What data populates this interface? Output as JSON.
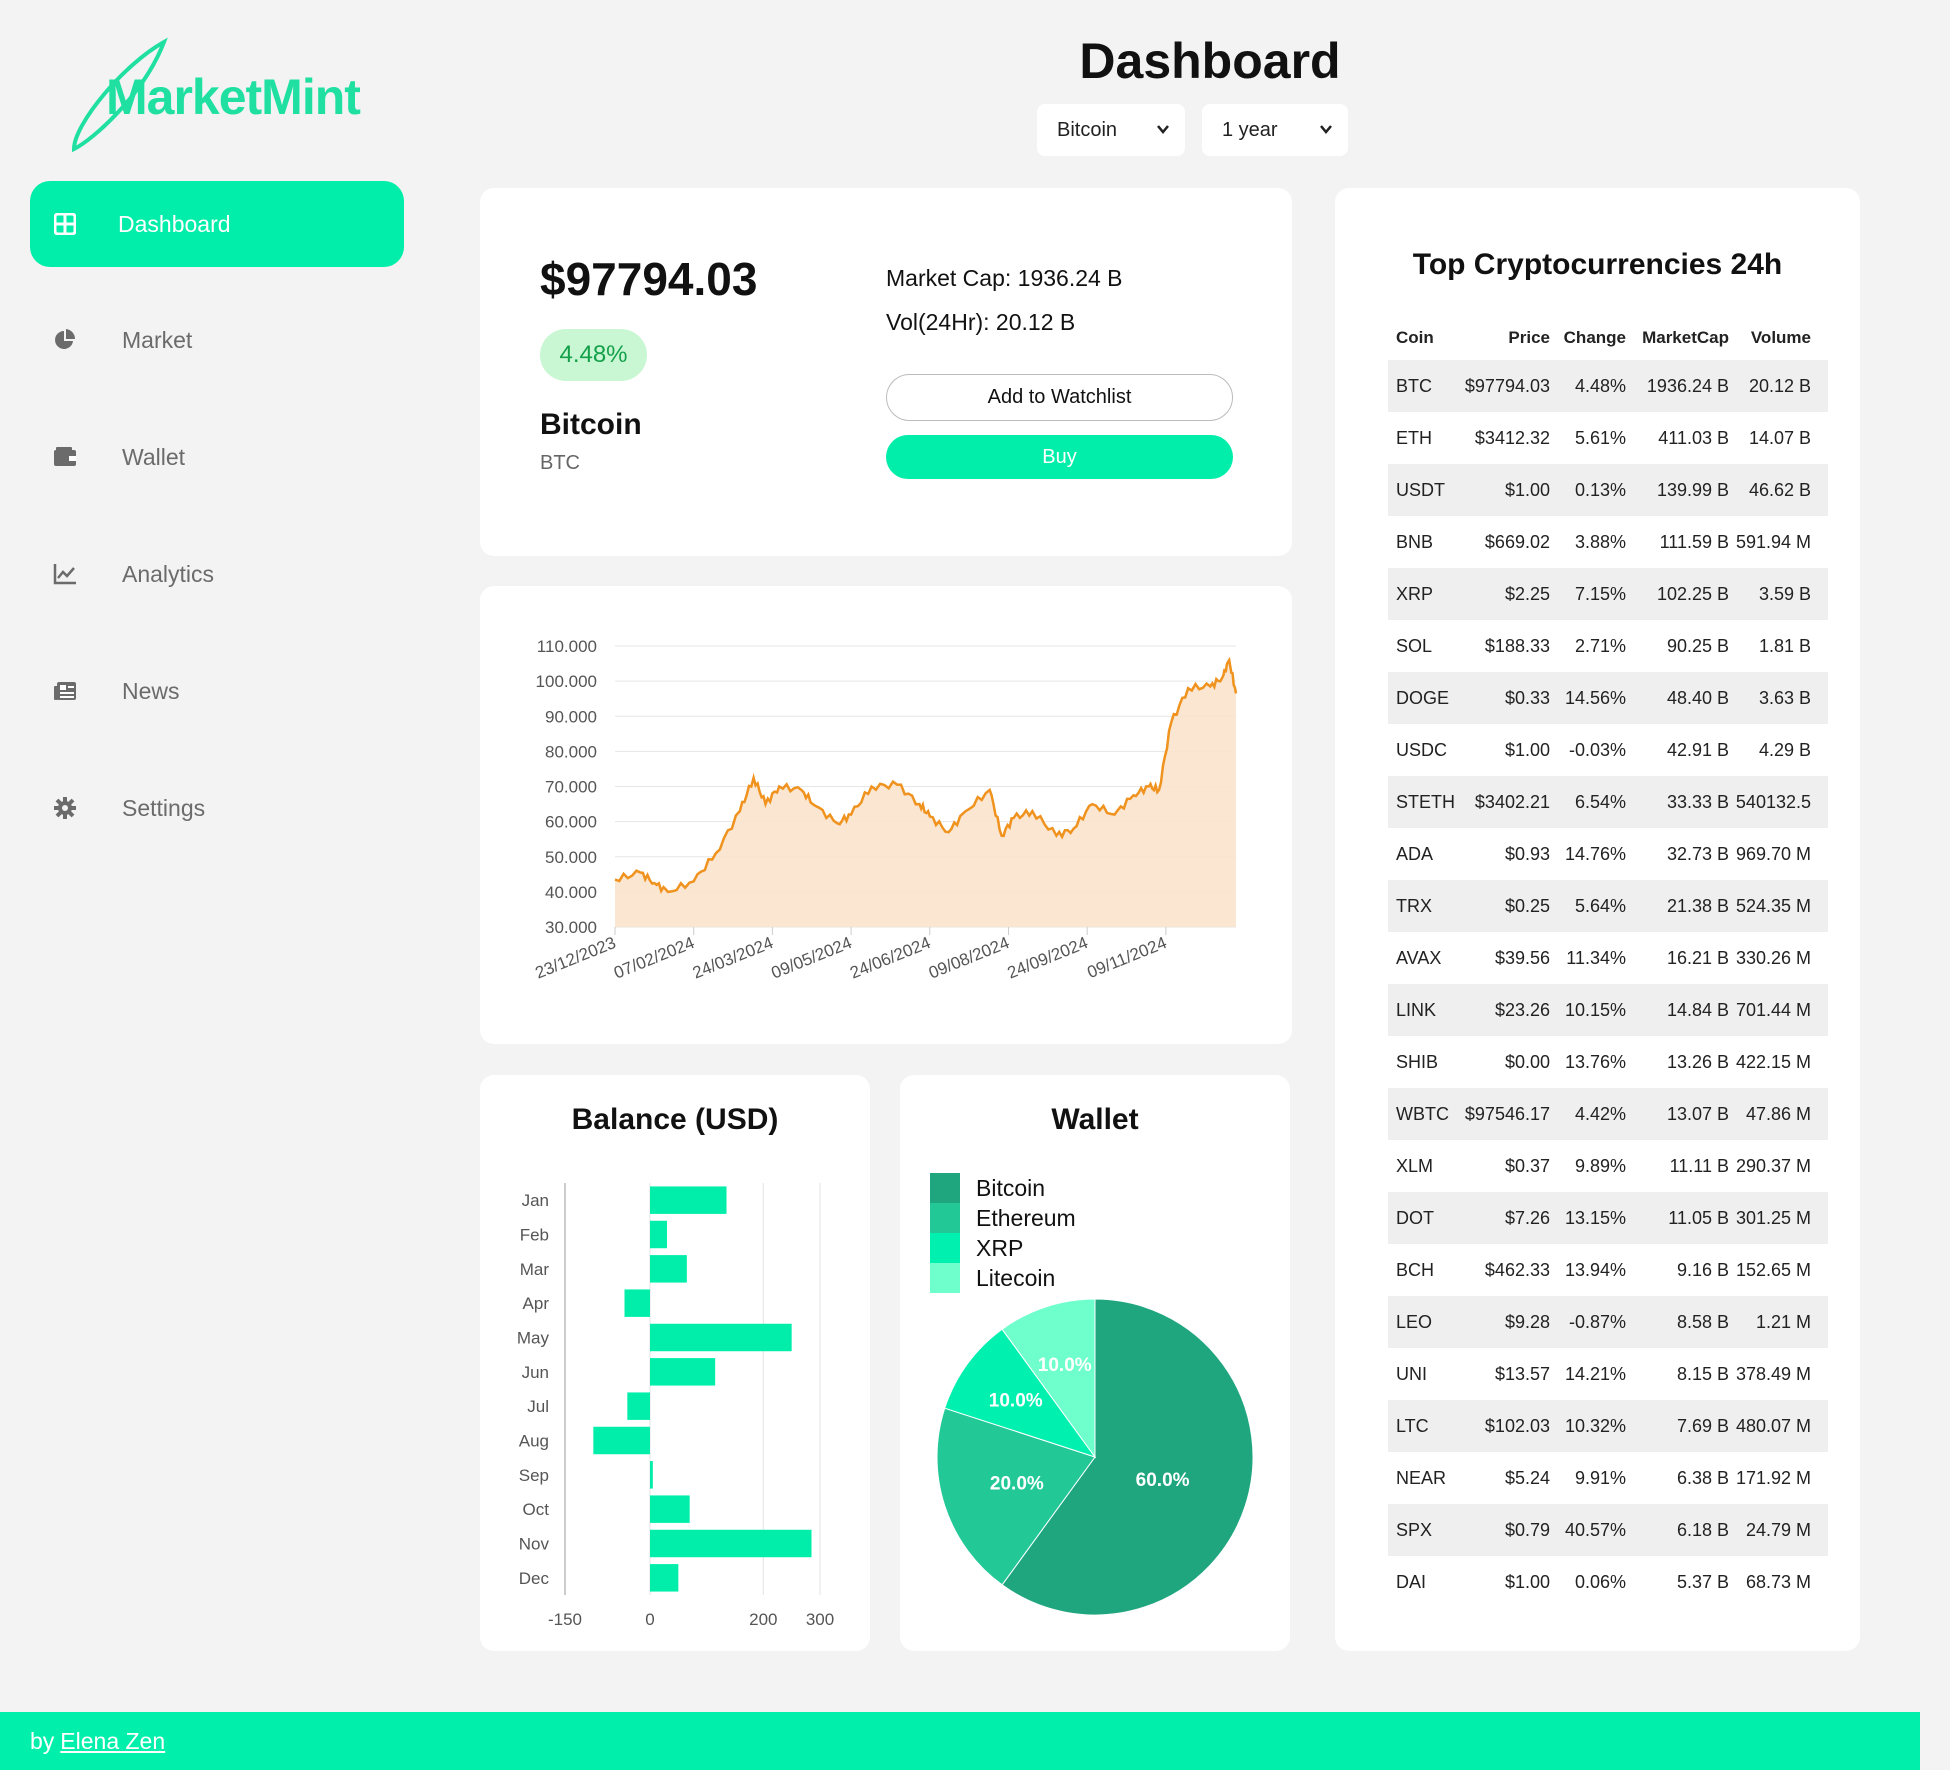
{
  "brand": {
    "name": "MarketMint",
    "accent": "#00eeaa"
  },
  "sidebar": {
    "items": [
      {
        "label": "Dashboard",
        "icon": "grid-icon",
        "active": true
      },
      {
        "label": "Market",
        "icon": "pie-chart-icon",
        "active": false
      },
      {
        "label": "Wallet",
        "icon": "wallet-icon",
        "active": false
      },
      {
        "label": "Analytics",
        "icon": "line-chart-icon",
        "active": false
      },
      {
        "label": "News",
        "icon": "newspaper-icon",
        "active": false
      },
      {
        "label": "Settings",
        "icon": "gear-icon",
        "active": false
      }
    ]
  },
  "header": {
    "title": "Dashboard",
    "coin_select": "Bitcoin",
    "period_select": "1 year"
  },
  "summary": {
    "price": "$97794.03",
    "change": "4.48%",
    "name": "Bitcoin",
    "symbol": "BTC",
    "market_cap": "Market Cap: 1936.24 B",
    "volume": "Vol(24Hr): 20.12 B",
    "watchlist_label": "Add to Watchlist",
    "buy_label": "Buy"
  },
  "top_table": {
    "title": "Top Cryptocurrencies 24h",
    "headers": [
      "Coin",
      "Price",
      "Change",
      "MarketCap",
      "Volume"
    ],
    "rows": [
      [
        "BTC",
        "$97794.03",
        "4.48%",
        "1936.24 B",
        "20.12 B"
      ],
      [
        "ETH",
        "$3412.32",
        "5.61%",
        "411.03 B",
        "14.07 B"
      ],
      [
        "USDT",
        "$1.00",
        "0.13%",
        "139.99 B",
        "46.62 B"
      ],
      [
        "BNB",
        "$669.02",
        "3.88%",
        "111.59 B",
        "591.94 M"
      ],
      [
        "XRP",
        "$2.25",
        "7.15%",
        "102.25 B",
        "3.59 B"
      ],
      [
        "SOL",
        "$188.33",
        "2.71%",
        "90.25 B",
        "1.81 B"
      ],
      [
        "DOGE",
        "$0.33",
        "14.56%",
        "48.40 B",
        "3.63 B"
      ],
      [
        "USDC",
        "$1.00",
        "-0.03%",
        "42.91 B",
        "4.29 B"
      ],
      [
        "STETH",
        "$3402.21",
        "6.54%",
        "33.33 B",
        "540132.5"
      ],
      [
        "ADA",
        "$0.93",
        "14.76%",
        "32.73 B",
        "969.70 M"
      ],
      [
        "TRX",
        "$0.25",
        "5.64%",
        "21.38 B",
        "524.35 M"
      ],
      [
        "AVAX",
        "$39.56",
        "11.34%",
        "16.21 B",
        "330.26 M"
      ],
      [
        "LINK",
        "$23.26",
        "10.15%",
        "14.84 B",
        "701.44 M"
      ],
      [
        "SHIB",
        "$0.00",
        "13.76%",
        "13.26 B",
        "422.15 M"
      ],
      [
        "WBTC",
        "$97546.17",
        "4.42%",
        "13.07 B",
        "47.86 M"
      ],
      [
        "XLM",
        "$0.37",
        "9.89%",
        "11.11 B",
        "290.37 M"
      ],
      [
        "DOT",
        "$7.26",
        "13.15%",
        "11.05 B",
        "301.25 M"
      ],
      [
        "BCH",
        "$462.33",
        "13.94%",
        "9.16 B",
        "152.65 M"
      ],
      [
        "LEO",
        "$9.28",
        "-0.87%",
        "8.58 B",
        "1.21 M"
      ],
      [
        "UNI",
        "$13.57",
        "14.21%",
        "8.15 B",
        "378.49 M"
      ],
      [
        "LTC",
        "$102.03",
        "10.32%",
        "7.69 B",
        "480.07 M"
      ],
      [
        "NEAR",
        "$5.24",
        "9.91%",
        "6.38 B",
        "171.92 M"
      ],
      [
        "SPX",
        "$0.79",
        "40.57%",
        "6.18 B",
        "24.79 M"
      ],
      [
        "DAI",
        "$1.00",
        "0.06%",
        "5.37 B",
        "68.73 M"
      ]
    ]
  },
  "footer": {
    "prefix": "by",
    "author": "Elena Zen"
  },
  "chart_data": [
    {
      "type": "area",
      "title": "",
      "color": "#f0921e",
      "fill": "#fae3cc",
      "ylim": [
        30000,
        110000
      ],
      "yticks": [
        "30.000",
        "40.000",
        "50.000",
        "60.000",
        "70.000",
        "80.000",
        "90.000",
        "100.000",
        "110.000"
      ],
      "xticks": [
        "23/12/2023",
        "07/02/2024",
        "24/03/2024",
        "09/05/2024",
        "24/06/2024",
        "09/08/2024",
        "24/09/2024",
        "09/11/2024"
      ],
      "x": [
        "2023-12-23",
        "2024-01-07",
        "2024-01-15",
        "2024-01-23",
        "2024-02-07",
        "2024-02-20",
        "2024-03-05",
        "2024-03-13",
        "2024-03-20",
        "2024-03-28",
        "2024-04-10",
        "2024-04-18",
        "2024-05-01",
        "2024-05-09",
        "2024-05-21",
        "2024-06-05",
        "2024-06-18",
        "2024-06-24",
        "2024-07-05",
        "2024-07-15",
        "2024-07-29",
        "2024-08-05",
        "2024-08-12",
        "2024-08-23",
        "2024-09-06",
        "2024-09-16",
        "2024-09-27",
        "2024-10-10",
        "2024-10-21",
        "2024-10-30",
        "2024-11-05",
        "2024-11-12",
        "2024-11-22",
        "2024-12-05",
        "2024-12-12",
        "2024-12-16",
        "2024-12-20"
      ],
      "y": [
        43500,
        45500,
        42500,
        40000,
        43000,
        51000,
        63000,
        72500,
        65000,
        70000,
        69000,
        64500,
        59500,
        62000,
        70000,
        70500,
        65000,
        61500,
        57000,
        63000,
        69000,
        56000,
        61000,
        63000,
        56000,
        58000,
        65000,
        62000,
        67500,
        70000,
        69000,
        88000,
        98000,
        98500,
        101000,
        106000,
        96500
      ]
    },
    {
      "type": "bar",
      "title": "Balance (USD)",
      "orientation": "horizontal",
      "color": "#00eeaa",
      "categories": [
        "Jan",
        "Feb",
        "Mar",
        "Apr",
        "May",
        "Jun",
        "Jul",
        "Aug",
        "Sep",
        "Oct",
        "Nov",
        "Dec"
      ],
      "values": [
        135,
        30,
        65,
        -45,
        250,
        115,
        -40,
        -100,
        5,
        70,
        285,
        50
      ],
      "xlim": [
        -150,
        300
      ],
      "xticks": [
        -150,
        0,
        200,
        300
      ]
    },
    {
      "type": "pie",
      "title": "Wallet",
      "labels": [
        "Bitcoin",
        "Ethereum",
        "XRP",
        "Litecoin"
      ],
      "values": [
        60,
        20,
        10,
        10
      ],
      "value_labels": [
        "60.0%",
        "20.0%",
        "10.0%",
        "10.0%"
      ],
      "colors": [
        "#1fa67f",
        "#22c997",
        "#00f0b0",
        "#6effcc"
      ],
      "legend": "top-left"
    }
  ]
}
